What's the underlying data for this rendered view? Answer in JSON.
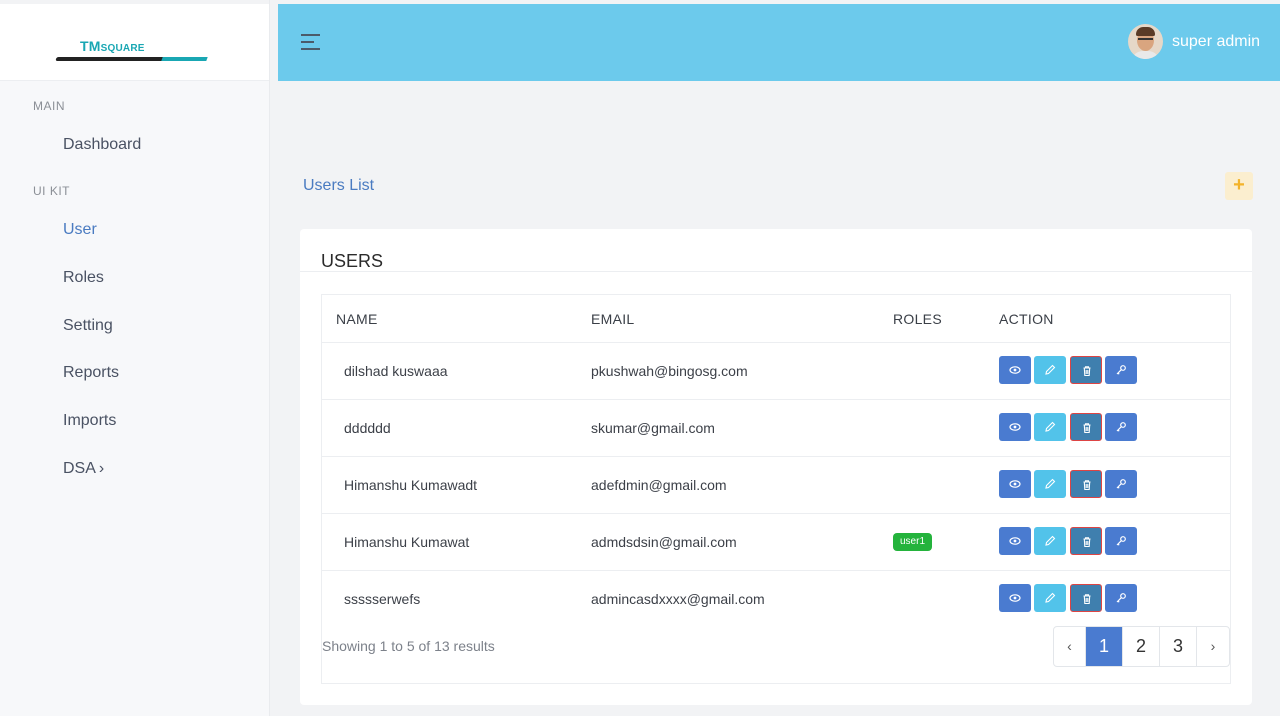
{
  "brand": {
    "logo_main": "TM",
    "logo_sub": "SQUARE"
  },
  "sidebar": {
    "sections": [
      {
        "label": "MAIN"
      },
      {
        "label": "UI KIT"
      }
    ],
    "items": [
      {
        "label": "Dashboard"
      },
      {
        "label": "User"
      },
      {
        "label": "Roles"
      },
      {
        "label": "Setting"
      },
      {
        "label": "Reports"
      },
      {
        "label": "Imports"
      },
      {
        "label": "DSA"
      }
    ],
    "active": "User",
    "dsa_chevron": "›"
  },
  "header": {
    "username": "super admin"
  },
  "page": {
    "title": "Users List",
    "add_icon": "+"
  },
  "card": {
    "title": "USERS",
    "columns": [
      "NAME",
      "EMAIL",
      "ROLES",
      "ACTION"
    ],
    "rows": [
      {
        "name": "dilshad kuswaaa",
        "email": "pkushwah@bingosg.com",
        "role": ""
      },
      {
        "name": "dddddd",
        "email": "skumar@gmail.com",
        "role": ""
      },
      {
        "name": "Himanshu Kumawadt",
        "email": "adefdmin@gmail.com",
        "role": ""
      },
      {
        "name": "Himanshu Kumawat",
        "email": "admdsdsin@gmail.com",
        "role": "user1"
      },
      {
        "name": "ssssserwefs",
        "email": "admincasdxxxx@gmail.com",
        "role": ""
      }
    ],
    "action_icons": [
      "eye-icon",
      "pencil-icon",
      "trash-icon",
      "key-icon"
    ],
    "footer": "Showing 1 to 5 of 13 results",
    "pagination": {
      "prev": "‹",
      "pages": [
        "1",
        "2",
        "3"
      ],
      "next": "›",
      "current": "1"
    }
  },
  "colors": {
    "topbar": "#6ccaec",
    "accent": "#4a7bd0",
    "edit": "#52c3ea",
    "badge": "#24b33c",
    "add_button": "#fbeecf"
  }
}
